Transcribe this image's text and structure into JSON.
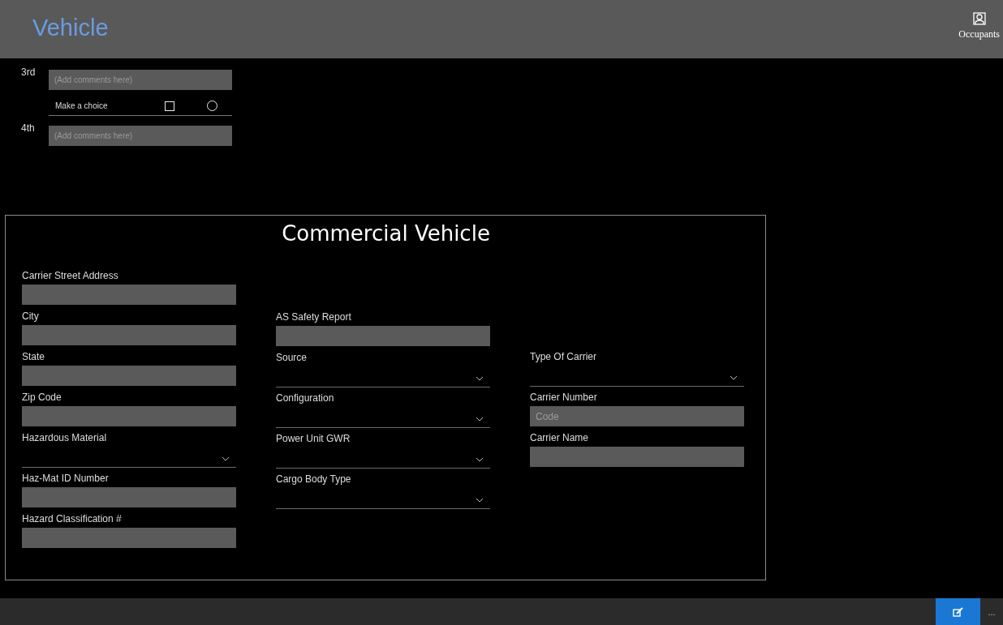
{
  "header": {
    "title": "Vehicle",
    "occupants_label": "Occupants"
  },
  "top_rows": [
    {
      "kind": "comment",
      "label": "3rd",
      "placeholder": "(Add comments here)"
    },
    {
      "kind": "choice",
      "label": "Make a choice",
      "checked": false,
      "selected": false
    },
    {
      "kind": "comment",
      "label": "4th",
      "placeholder": "(Add comments here)"
    }
  ],
  "commercial": {
    "title": "Commercial Vehicle",
    "columns": [
      {
        "fields": [
          {
            "kind": "text",
            "label": "Carrier Street Address"
          },
          {
            "kind": "text",
            "label": "City"
          },
          {
            "kind": "text",
            "label": "State"
          },
          {
            "kind": "text",
            "label": "Zip Code"
          },
          {
            "kind": "dropdown",
            "label": "Hazardous Material"
          },
          {
            "kind": "text",
            "label": "Haz-Mat ID Number"
          },
          {
            "kind": "text",
            "label": "Hazard Classification #"
          }
        ]
      },
      {
        "fields": [
          {
            "kind": "text",
            "label": "AS Safety Report"
          },
          {
            "kind": "dropdown",
            "label": "Source"
          },
          {
            "kind": "dropdown",
            "label": "Configuration"
          },
          {
            "kind": "dropdown",
            "label": "Power Unit GWR"
          },
          {
            "kind": "dropdown",
            "label": "Cargo Body Type"
          }
        ]
      },
      {
        "fields": [
          {
            "kind": "dropdown",
            "label": "Type Of Carrier"
          },
          {
            "kind": "text",
            "label": "Carrier Number",
            "placeholder": "Code"
          },
          {
            "kind": "text",
            "label": "Carrier Name"
          }
        ]
      }
    ]
  },
  "command_bar": {
    "more_label": "..."
  }
}
